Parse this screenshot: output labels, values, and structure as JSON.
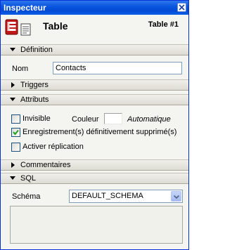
{
  "window": {
    "title": "Inspecteur"
  },
  "header": {
    "kind": "Table",
    "name": "Table #1"
  },
  "sections": {
    "definition": "Définition",
    "triggers": "Triggers",
    "attributes": "Attributs",
    "comments": "Commentaires",
    "sql": "SQL"
  },
  "definition": {
    "name_label": "Nom",
    "name_value": "Contacts"
  },
  "attributes": {
    "invisible_label": "Invisible",
    "invisible_checked": false,
    "color_label": "Couleur",
    "color_value": "Automatique",
    "deleted_label": "Enregistrement(s) définitivement supprimé(s)",
    "deleted_checked": true,
    "replication_label": "Activer réplication",
    "replication_checked": false
  },
  "sql": {
    "schema_label": "Schéma",
    "schema_value": "DEFAULT_SCHEMA"
  },
  "icons": {
    "close": "close-icon",
    "table": "table-icon",
    "document": "document-icon",
    "expanded": "triangle-down-icon",
    "collapsed": "triangle-right-icon",
    "dropdown": "chevron-down-icon"
  }
}
